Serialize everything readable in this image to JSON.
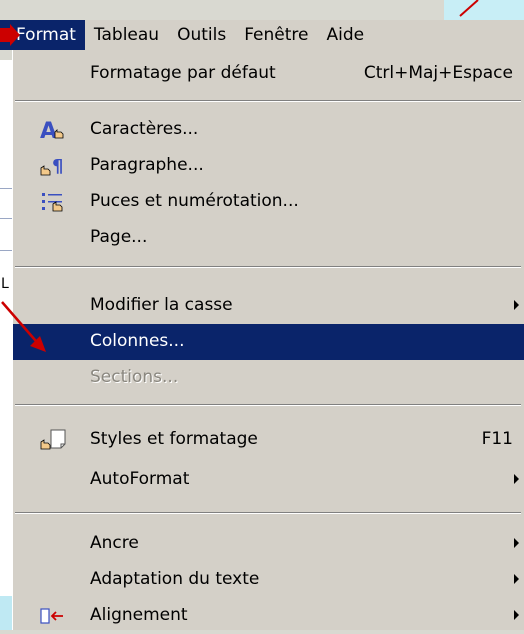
{
  "menubar": {
    "items": [
      {
        "label": "Format",
        "active": true
      },
      {
        "label": "Tableau"
      },
      {
        "label": "Outils"
      },
      {
        "label": "Fenêtre"
      },
      {
        "label": "Aide"
      }
    ]
  },
  "background": {
    "letter": "L"
  },
  "menu": {
    "items": [
      {
        "label": "Formatage par défaut",
        "shortcut": "Ctrl+Maj+Espace"
      },
      {
        "label": "Caractères...",
        "icon": "character-icon"
      },
      {
        "label": "Paragraphe...",
        "icon": "paragraph-icon"
      },
      {
        "label": "Puces et numérotation...",
        "icon": "bullets-icon"
      },
      {
        "label": "Page..."
      },
      {
        "label": "Modifier la casse",
        "submenu": true
      },
      {
        "label": "Colonnes...",
        "highlighted": true
      },
      {
        "label": "Sections...",
        "disabled": true
      },
      {
        "label": "Styles et formatage",
        "shortcut": "F11",
        "icon": "styles-icon"
      },
      {
        "label": "AutoFormat",
        "submenu": true
      },
      {
        "label": "Ancre",
        "submenu": true
      },
      {
        "label": "Adaptation du texte",
        "submenu": true
      },
      {
        "label": "Alignement",
        "submenu": true,
        "icon": "alignment-icon"
      }
    ]
  },
  "colors": {
    "menu_bg": "#d4d0c8",
    "highlight": "#0a246a",
    "annotation_arrow": "#cc0000",
    "annotation_bg": "#c8eef6"
  }
}
